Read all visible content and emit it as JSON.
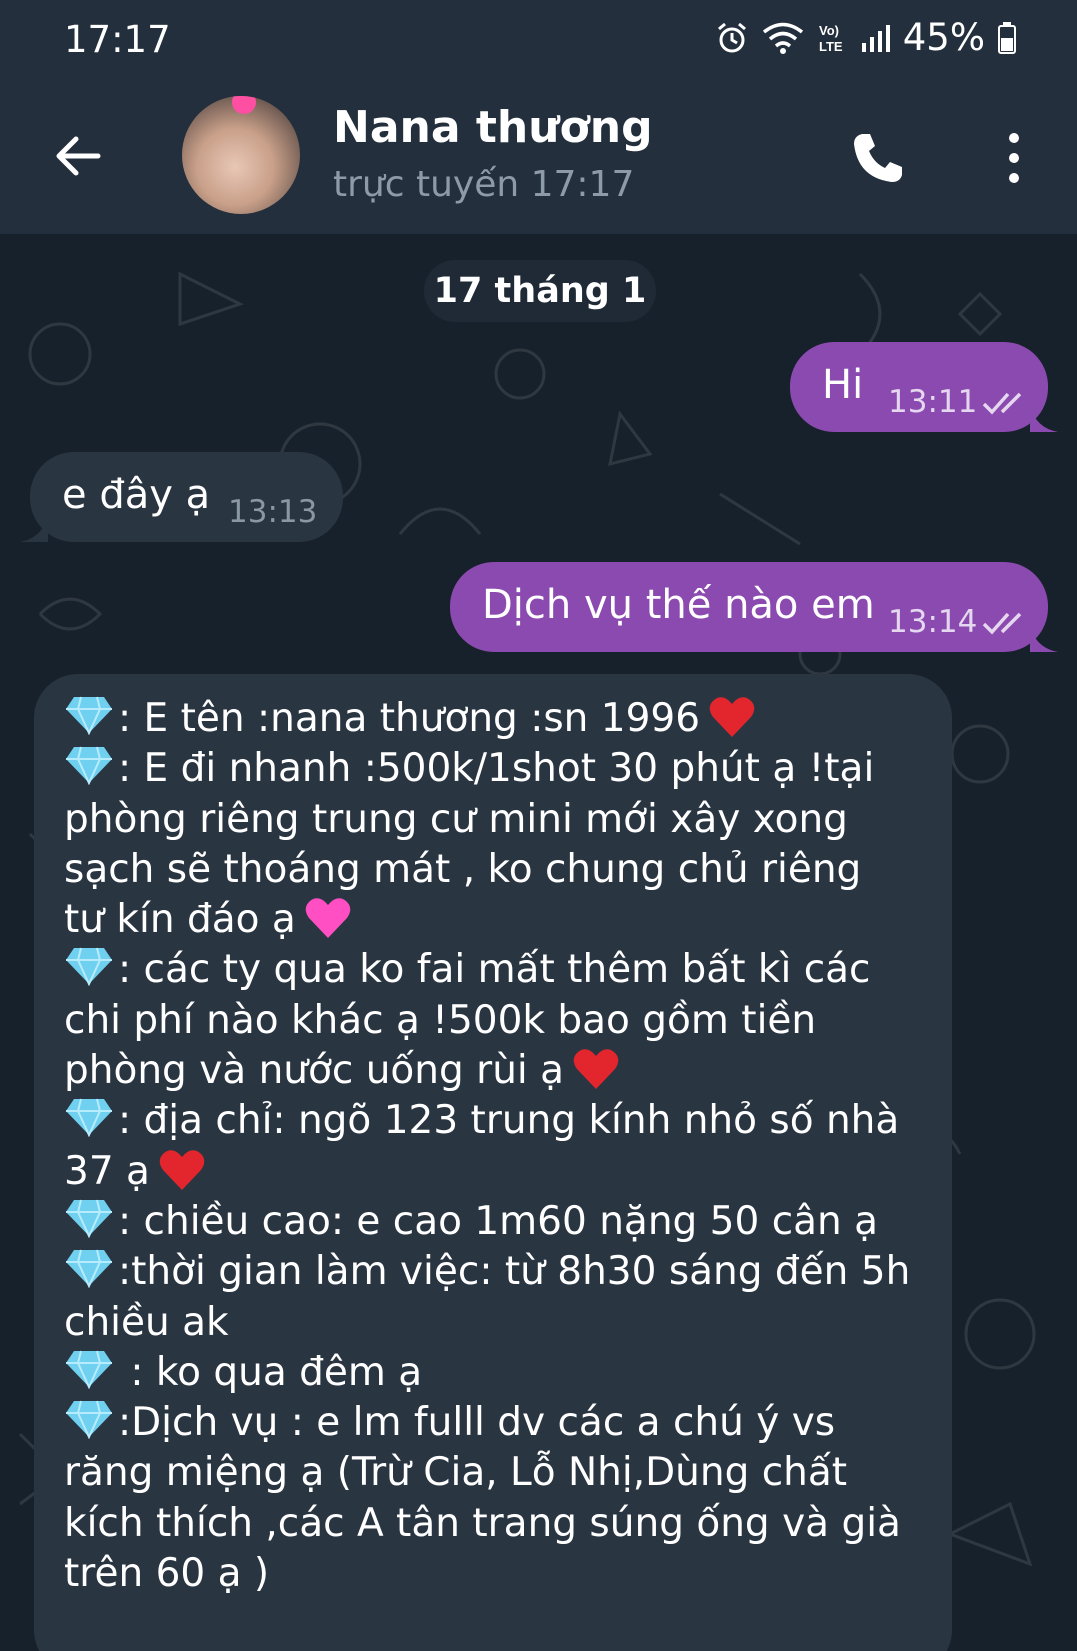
{
  "status_bar": {
    "time": "17:17",
    "battery": "45%",
    "icons": [
      "alarm-icon",
      "wifi-icon",
      "volte-icon",
      "signal-icon",
      "battery-icon"
    ]
  },
  "header": {
    "name": "Nana thương",
    "status": "trực tuyến 17:17",
    "icons": [
      "back-arrow-icon",
      "phone-icon",
      "more-vert-icon"
    ]
  },
  "chat": {
    "date_chip": "17 tháng 1",
    "messages": [
      {
        "direction": "out",
        "text": "Hi",
        "time": "13:11",
        "read": true
      },
      {
        "direction": "in",
        "text": "e đây ạ",
        "time": "13:13"
      },
      {
        "direction": "out",
        "text": "Dịch vụ thế nào em",
        "time": "13:14",
        "read": true
      }
    ],
    "long_message": {
      "lines": [
        ": E tên :nana thương :sn 1996",
        ": E đi nhanh :500k/1shot 30 phút ạ !tại",
        "phòng riêng trung cư mini mới xây xong",
        "sạch sẽ thoáng mát , ko chung chủ riêng",
        "tư kín đáo ạ",
        ": các ty qua ko fai mất thêm bất kì các",
        "chi phí nào khác ạ !500k bao gồm tiền",
        "phòng và nước uống rùi ạ",
        ": địa chỉ: ngõ 123 trung kính nhỏ số nhà",
        "37 ạ",
        ": chiều cao: e cao 1m60 nặng 50 cân ạ",
        ":thời gian làm việc: từ 8h30 sáng đến 5h",
        "chiều ak",
        " : ko qua đêm ạ",
        ":Dịch vụ : e lm fulll dv các a chú ý vs",
        "răng miệng ạ (Trừ Cia, Lỗ Nhị,Dùng chất",
        "kích thích ,các A tân trang súng ống và già",
        "trên 60 ạ )"
      ],
      "emoji": {
        "gem": "diamond-emoji",
        "red_heart": "red-heart-emoji",
        "pink_heart": "pink-heart-emoji"
      }
    }
  },
  "colors": {
    "header_bg": "#242f3d",
    "chat_bg": "#17212b",
    "outgoing_bubble": "#8b4aaf",
    "incoming_bubble": "#2a3542",
    "status_text": "#8d9aa7"
  }
}
